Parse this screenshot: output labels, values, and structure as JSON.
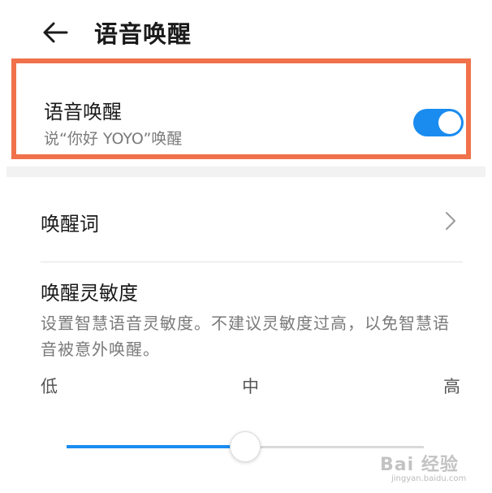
{
  "header": {
    "title": "语音唤醒",
    "back_icon": "arrow-left-icon"
  },
  "voice_wakeup": {
    "title": "语音唤醒",
    "subtitle": "说“你好 YOYO”唤醒",
    "enabled": true,
    "toggle_color": "#1a8cf0",
    "highlight_color": "#f0714a"
  },
  "wake_word": {
    "label": "唤醒词",
    "chevron_icon": "chevron-right-icon"
  },
  "sensitivity": {
    "title": "唤醒灵敏度",
    "description": "设置智慧语音灵敏度。不建议灵敏度过高，以免智慧语音被意外唤醒。",
    "ticks": {
      "low": "低",
      "mid": "中",
      "high": "高"
    },
    "value": 0.5,
    "accent": "#1a8cf0"
  },
  "watermark": {
    "text": "Bai 经验",
    "sub": "jingyan.baidu.com"
  }
}
